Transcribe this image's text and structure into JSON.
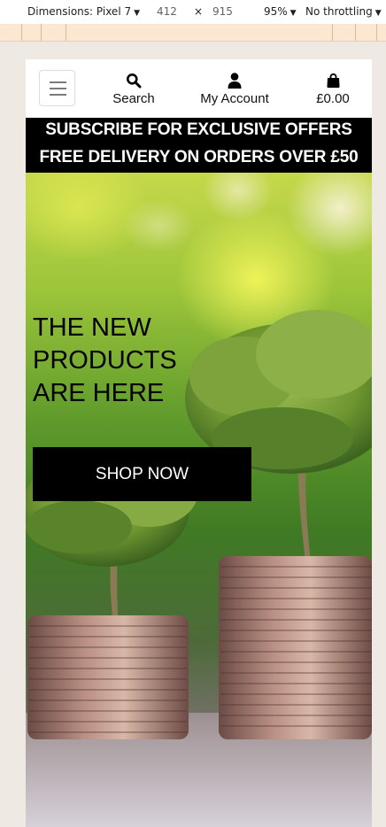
{
  "devtools": {
    "device_label": "Dimensions: Pixel 7",
    "width": "412",
    "times": "×",
    "height": "915",
    "zoom": "95%",
    "throttling": "No throttling"
  },
  "header": {
    "menu_icon": "hamburger-icon",
    "search_label": "Search",
    "search_icon": "search-icon",
    "account_label": "My Account",
    "account_icon": "user-icon",
    "cart_label": "£0.00",
    "cart_icon": "shopping-bag-icon"
  },
  "banner": {
    "line1": "SUBSCRIBE FOR EXCLUSIVE OFFERS",
    "line2": "FREE DELIVERY ON ORDERS OVER £50"
  },
  "hero": {
    "title_lines": [
      "THE NEW",
      "PRODUCTS",
      "ARE HERE"
    ],
    "cta_label": "SHOP NOW",
    "image": "trees growing on stacks of coins"
  },
  "colors": {
    "banner_bg": "#000000",
    "banner_text": "#ffffff",
    "cta_bg": "#000000",
    "cta_text": "#ffffff"
  }
}
